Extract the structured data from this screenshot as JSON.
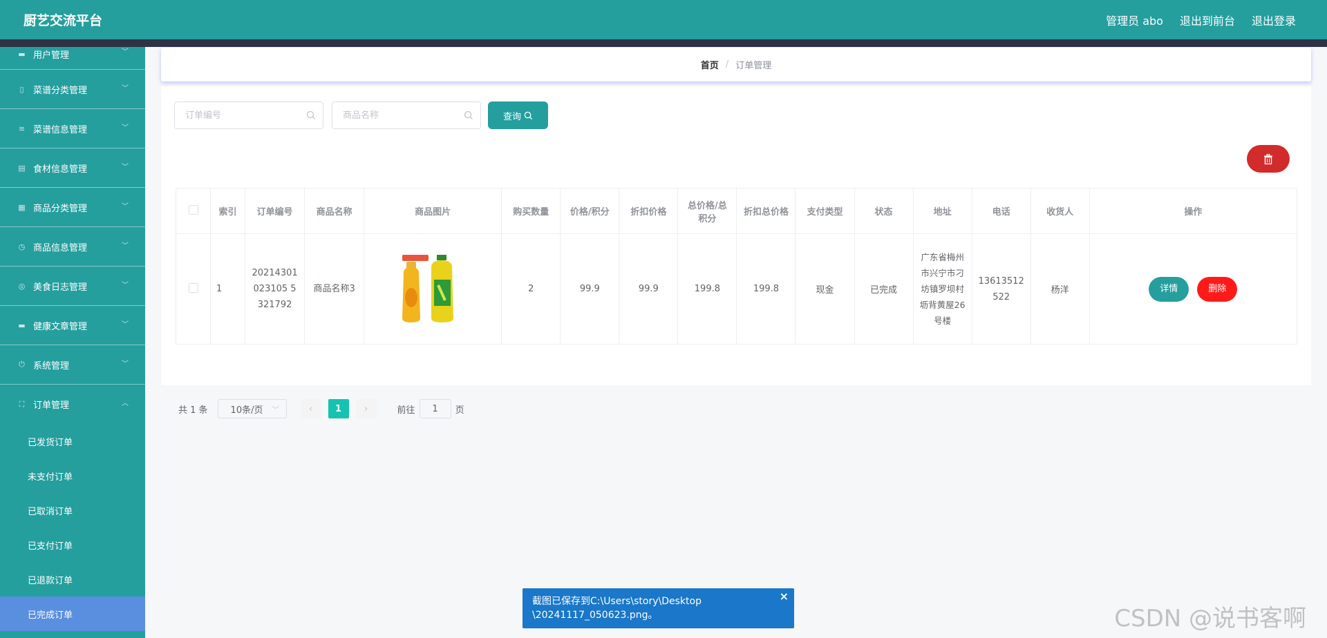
{
  "app": {
    "title": "厨艺交流平台"
  },
  "header": {
    "admin_label": "管理员 abo",
    "front_link": "退出到前台",
    "logout_link": "退出登录"
  },
  "sidebar": {
    "items": [
      {
        "label": "用户管理",
        "icon": "user-icon"
      },
      {
        "label": "菜谱分类管理",
        "icon": "phone-icon"
      },
      {
        "label": "菜谱信息管理",
        "icon": "sliders-icon"
      },
      {
        "label": "食材信息管理",
        "icon": "clipboard-icon"
      },
      {
        "label": "商品分类管理",
        "icon": "grid-icon"
      },
      {
        "label": "商品信息管理",
        "icon": "clock-icon"
      },
      {
        "label": "美食日志管理",
        "icon": "globe-icon"
      },
      {
        "label": "健康文章管理",
        "icon": "chat-icon"
      },
      {
        "label": "系统管理",
        "icon": "power-icon"
      },
      {
        "label": "订单管理",
        "icon": "frame-icon"
      }
    ],
    "subitems": [
      {
        "label": "已发货订单"
      },
      {
        "label": "未支付订单"
      },
      {
        "label": "已取消订单"
      },
      {
        "label": "已支付订单"
      },
      {
        "label": "已退款订单"
      },
      {
        "label": "已完成订单"
      }
    ]
  },
  "breadcrumb": {
    "home": "首页",
    "separator": "/",
    "current": "订单管理"
  },
  "search": {
    "order_placeholder": "订单编号",
    "name_placeholder": "商品名称",
    "query_label": "查询"
  },
  "table": {
    "headers": [
      "索引",
      "订单编号",
      "商品名称",
      "商品图片",
      "购买数量",
      "价格/积分",
      "折扣价格",
      "总价格/总积分",
      "折扣总价格",
      "支付类型",
      "状态",
      "地址",
      "电话",
      "收货人",
      "操作"
    ],
    "rows": [
      {
        "index": "1",
        "order_no": "20214301023105 5321792",
        "name": "商品名称3",
        "image_alt": "cooking-oil-bottles",
        "qty": "2",
        "price": "99.9",
        "discount_price": "99.9",
        "total": "199.8",
        "discount_total": "199.8",
        "pay_type": "现金",
        "status": "已完成",
        "address": "广东省梅州市兴宁市刁坊镇罗坝村坜背黄屋26号楼",
        "phone": "13613512522",
        "receiver": "杨洋",
        "detail_label": "详情",
        "delete_label": "删除"
      }
    ]
  },
  "pager": {
    "total": "共 1 条",
    "page_size": "10条/页",
    "current_page": "1",
    "goto_prefix": "前往",
    "goto_value": "1",
    "goto_suffix": "页"
  },
  "toast": {
    "line1": "截图已保存到C:\\Users\\story\\Desktop",
    "line2": "\\20241117_050623.png。",
    "close": "×"
  },
  "watermark": "CSDN @说书客啊",
  "colors": {
    "primary": "#259e9e",
    "danger": "#d22b2b",
    "delete_btn": "#ff1a1a",
    "active_sub": "#5a8fe0",
    "pager_active": "#16c2b0",
    "toast": "#1a77c9"
  }
}
